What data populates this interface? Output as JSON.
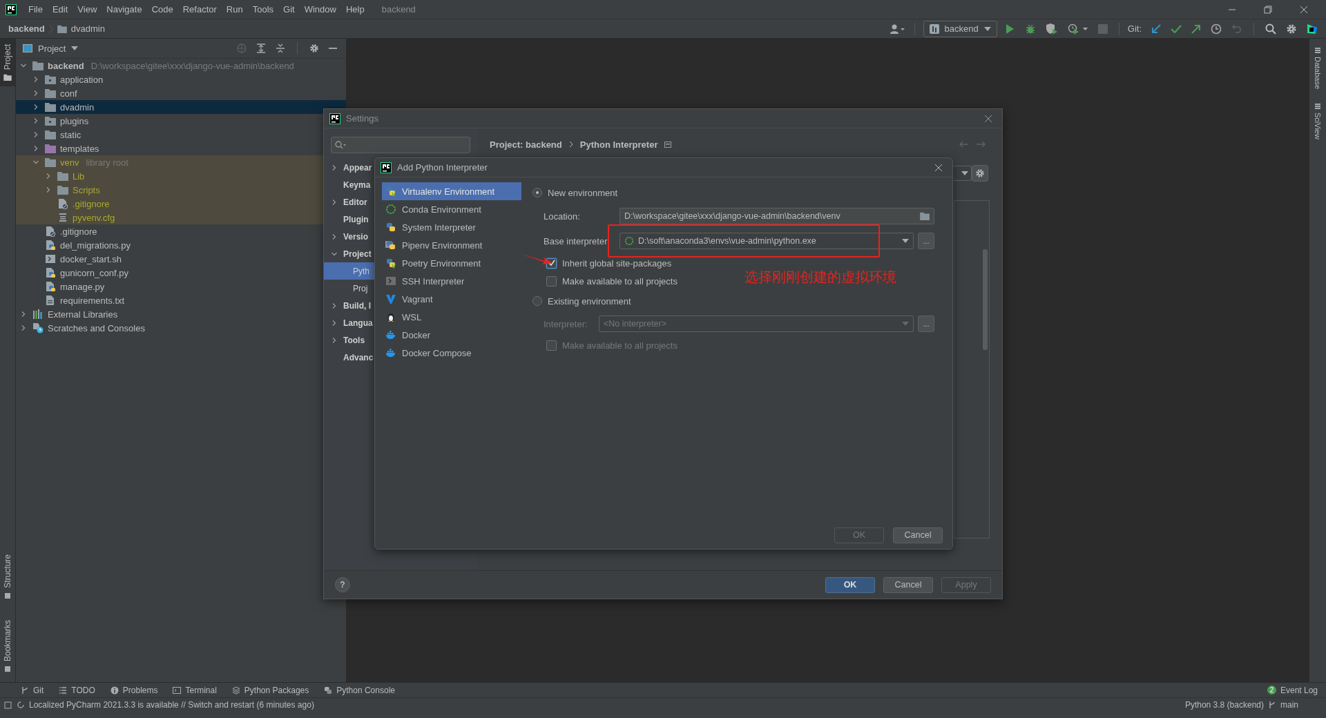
{
  "menu": [
    "File",
    "Edit",
    "View",
    "Navigate",
    "Code",
    "Refactor",
    "Run",
    "Tools",
    "Git",
    "Window",
    "Help"
  ],
  "window_title": "backend",
  "breadcrumb": [
    "backend",
    "dvadmin"
  ],
  "run_config": "backend",
  "git_label": "Git:",
  "left_strip": {
    "top": [
      {
        "label": "Project",
        "selected": true
      }
    ],
    "bottom": [
      {
        "label": "Structure",
        "selected": false
      },
      {
        "label": "Bookmarks",
        "selected": false
      }
    ]
  },
  "right_strip": [
    {
      "label": "Database",
      "selected": false
    },
    {
      "label": "SciView",
      "selected": false
    }
  ],
  "project_panel": {
    "title": "Project",
    "tree": [
      {
        "name": "backend",
        "kind": "folder",
        "hint": "D:\\workspace\\gitee\\xxx\\django-vue-admin\\backend",
        "expanded": true,
        "selected": false,
        "children": [
          {
            "name": "application",
            "kind": "module-folder",
            "expanded": false,
            "selected": false
          },
          {
            "name": "conf",
            "kind": "folder",
            "expanded": false,
            "selected": false
          },
          {
            "name": "dvadmin",
            "kind": "folder",
            "expanded": false,
            "selected": true
          },
          {
            "name": "plugins",
            "kind": "module-folder",
            "expanded": false,
            "selected": false
          },
          {
            "name": "static",
            "kind": "folder",
            "expanded": false,
            "selected": false
          },
          {
            "name": "templates",
            "kind": "template-folder",
            "expanded": false,
            "selected": false
          },
          {
            "name": "venv",
            "kind": "folder",
            "hint": "library root",
            "library": true,
            "expanded": true,
            "selected": false,
            "children": [
              {
                "name": "Lib",
                "kind": "folder",
                "expanded": false,
                "selected": false
              },
              {
                "name": "Scripts",
                "kind": "folder",
                "expanded": false,
                "selected": false
              },
              {
                "name": ".gitignore",
                "kind": "file-ignore",
                "selected": false
              },
              {
                "name": "pyvenv.cfg",
                "kind": "file-config",
                "selected": false
              }
            ]
          },
          {
            "name": ".gitignore",
            "kind": "file-ignore",
            "selected": false
          },
          {
            "name": "del_migrations.py",
            "kind": "file-python",
            "selected": false
          },
          {
            "name": "docker_start.sh",
            "kind": "file-shell",
            "selected": false
          },
          {
            "name": "gunicorn_conf.py",
            "kind": "file-python",
            "selected": false
          },
          {
            "name": "manage.py",
            "kind": "file-python",
            "selected": false
          },
          {
            "name": "requirements.txt",
            "kind": "file-text",
            "selected": false
          }
        ]
      },
      {
        "name": "External Libraries",
        "kind": "libraries",
        "expanded": false,
        "selected": false
      },
      {
        "name": "Scratches and Consoles",
        "kind": "scratches",
        "expanded": false,
        "selected": false
      }
    ]
  },
  "settings": {
    "title": "Settings",
    "nav": [
      {
        "label": "Appear",
        "expanded": false,
        "selected": false
      },
      {
        "label": "Keyma",
        "selected": false
      },
      {
        "label": "Editor",
        "expanded": false,
        "selected": false
      },
      {
        "label": "Plugin",
        "selected": false
      },
      {
        "label": "Versio",
        "expanded": false,
        "selected": false
      },
      {
        "label": "Project",
        "expanded": true,
        "selected": false,
        "children": [
          {
            "label": "Pyth",
            "selected": true
          },
          {
            "label": "Proj",
            "selected": false
          }
        ]
      },
      {
        "label": "Build, I",
        "expanded": false,
        "selected": false
      },
      {
        "label": "Langua",
        "expanded": false,
        "selected": false
      },
      {
        "label": "Tools",
        "expanded": false,
        "selected": false
      },
      {
        "label": "Advanc",
        "selected": false
      }
    ],
    "path": [
      "Project: backend",
      "Python Interpreter"
    ],
    "help": "?",
    "buttons": [
      {
        "label": "OK",
        "default": true,
        "disabled": false
      },
      {
        "label": "Cancel",
        "default": false,
        "disabled": false
      },
      {
        "label": "Apply",
        "default": false,
        "disabled": true
      }
    ]
  },
  "add_interpreter": {
    "title": "Add Python Interpreter",
    "types": [
      {
        "name": "Virtualenv Environment",
        "kind": "python-v",
        "selected": true
      },
      {
        "name": "Conda Environment",
        "kind": "conda",
        "selected": false
      },
      {
        "name": "System Interpreter",
        "kind": "python",
        "selected": false
      },
      {
        "name": "Pipenv Environment",
        "kind": "pipenv",
        "selected": false
      },
      {
        "name": "Poetry Environment",
        "kind": "python-v",
        "selected": false
      },
      {
        "name": "SSH Interpreter",
        "kind": "ssh",
        "selected": false
      },
      {
        "name": "Vagrant",
        "kind": "vagrant",
        "selected": false
      },
      {
        "name": "WSL",
        "kind": "penguin",
        "selected": false
      },
      {
        "name": "Docker",
        "kind": "docker",
        "selected": false
      },
      {
        "name": "Docker Compose",
        "kind": "docker",
        "selected": false
      }
    ],
    "new_environment": {
      "label": "New environment",
      "selected": true,
      "location": {
        "label": "Location:",
        "value": "D:\\workspace\\gitee\\xxx\\django-vue-admin\\backend\\venv"
      },
      "base_interpreter": {
        "label": "Base interpreter:",
        "value": "D:\\soft\\anaconda3\\envs\\vue-admin\\python.exe",
        "browse": "..."
      },
      "options": [
        {
          "label": "Inherit global site-packages",
          "checked": true
        },
        {
          "label": "Make available to all projects",
          "checked": false
        }
      ]
    },
    "existing_environment": {
      "label": "Existing environment",
      "selected": false,
      "interpreter": {
        "label": "Interpreter:",
        "placeholder": "<No interpreter>",
        "browse": "..."
      },
      "options": [
        {
          "label": "Make available to all projects",
          "checked": false
        }
      ]
    },
    "buttons": [
      {
        "label": "OK",
        "disabled": true
      },
      {
        "label": "Cancel",
        "disabled": false
      }
    ]
  },
  "annotation": {
    "text": "选择刚刚创建的虚拟环境"
  },
  "tool_windows": [
    {
      "label": "Git",
      "kind": "git"
    },
    {
      "label": "TODO",
      "kind": "list"
    },
    {
      "label": "Problems",
      "kind": "info"
    },
    {
      "label": "Terminal",
      "kind": "terminal"
    },
    {
      "label": "Python Packages",
      "kind": "layers"
    },
    {
      "label": "Python Console",
      "kind": "python"
    }
  ],
  "event_log": {
    "label": "Event Log",
    "count": "2"
  },
  "status": {
    "message": "Localized PyCharm 2021.3.3 is available // Switch and restart (6 minutes ago)",
    "interpreter": "Python 3.8 (backend)",
    "branch": "main"
  }
}
